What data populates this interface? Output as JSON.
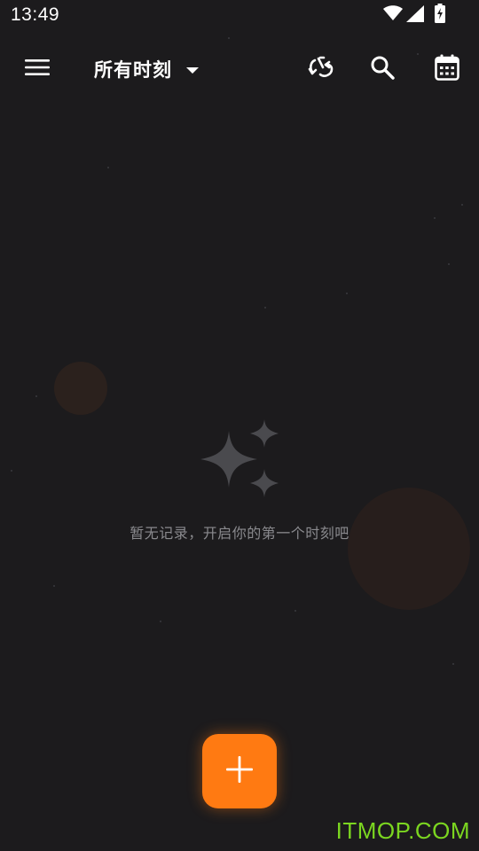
{
  "status_bar": {
    "time": "13:49",
    "icons": [
      "wifi-icon",
      "cellular-signal-icon",
      "battery-charging-icon"
    ]
  },
  "app_bar": {
    "title": "所有时刻",
    "icons": {
      "menu": "menu-icon",
      "sync": "sync-icon",
      "search": "search-icon",
      "calendar": "calendar-icon",
      "dropdown": "chevron-down-icon"
    }
  },
  "empty_state": {
    "icon": "sparkle-icon",
    "message": "暂无记录，开启你的第一个时刻吧"
  },
  "fab": {
    "icon": "plus-icon"
  },
  "watermark": {
    "text": "ITMOP.COM"
  },
  "colors": {
    "background": "#1c1b1d",
    "accent": "#ff7a12",
    "muted_text": "#8a8a8e",
    "icon": "#ffffff",
    "watermark": "#7bd620"
  }
}
